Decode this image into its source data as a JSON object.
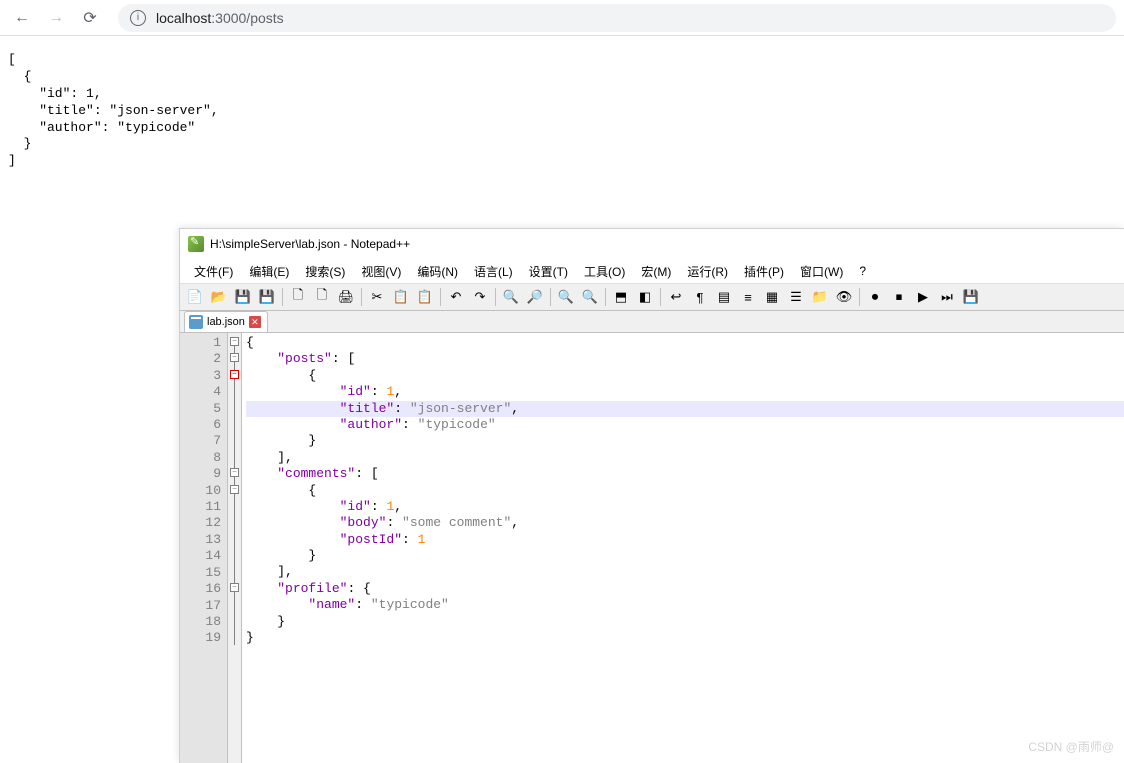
{
  "browser": {
    "url_host": "localhost",
    "url_port_path": ":3000/posts",
    "content_lines": [
      "[",
      "  {",
      "    \"id\": 1,",
      "    \"title\": \"json-server\",",
      "    \"author\": \"typicode\"",
      "  }",
      "]"
    ]
  },
  "notepad": {
    "title": "H:\\simpleServer\\lab.json - Notepad++",
    "menu": [
      "文件(F)",
      "编辑(E)",
      "搜索(S)",
      "视图(V)",
      "编码(N)",
      "语言(L)",
      "设置(T)",
      "工具(O)",
      "宏(M)",
      "运行(R)",
      "插件(P)",
      "窗口(W)",
      "?"
    ],
    "tab_label": "lab.json",
    "line_count": 19,
    "highlighted_line": 5,
    "code_lines": [
      {
        "indent": "",
        "tokens": [
          {
            "t": "brace",
            "v": "{"
          }
        ]
      },
      {
        "indent": "    ",
        "tokens": [
          {
            "t": "key",
            "v": "\"posts\""
          },
          {
            "t": "colon",
            "v": ": "
          },
          {
            "t": "brace",
            "v": "["
          }
        ]
      },
      {
        "indent": "        ",
        "tokens": [
          {
            "t": "brace",
            "v": "{"
          }
        ]
      },
      {
        "indent": "            ",
        "tokens": [
          {
            "t": "key",
            "v": "\"id\""
          },
          {
            "t": "colon",
            "v": ": "
          },
          {
            "t": "num",
            "v": "1"
          },
          {
            "t": "brace",
            "v": ","
          }
        ]
      },
      {
        "indent": "            ",
        "tokens": [
          {
            "t": "key",
            "v": "\"title\""
          },
          {
            "t": "colon",
            "v": ": "
          },
          {
            "t": "str",
            "v": "\"json-server\""
          },
          {
            "t": "brace",
            "v": ","
          }
        ]
      },
      {
        "indent": "            ",
        "tokens": [
          {
            "t": "key",
            "v": "\"author\""
          },
          {
            "t": "colon",
            "v": ": "
          },
          {
            "t": "str",
            "v": "\"typicode\""
          }
        ]
      },
      {
        "indent": "        ",
        "tokens": [
          {
            "t": "brace",
            "v": "}"
          }
        ]
      },
      {
        "indent": "    ",
        "tokens": [
          {
            "t": "brace",
            "v": "],"
          }
        ]
      },
      {
        "indent": "    ",
        "tokens": [
          {
            "t": "key",
            "v": "\"comments\""
          },
          {
            "t": "colon",
            "v": ": "
          },
          {
            "t": "brace",
            "v": "["
          }
        ]
      },
      {
        "indent": "        ",
        "tokens": [
          {
            "t": "brace",
            "v": "{"
          }
        ]
      },
      {
        "indent": "            ",
        "tokens": [
          {
            "t": "key",
            "v": "\"id\""
          },
          {
            "t": "colon",
            "v": ": "
          },
          {
            "t": "num",
            "v": "1"
          },
          {
            "t": "brace",
            "v": ","
          }
        ]
      },
      {
        "indent": "            ",
        "tokens": [
          {
            "t": "key",
            "v": "\"body\""
          },
          {
            "t": "colon",
            "v": ": "
          },
          {
            "t": "str",
            "v": "\"some comment\""
          },
          {
            "t": "brace",
            "v": ","
          }
        ]
      },
      {
        "indent": "            ",
        "tokens": [
          {
            "t": "key",
            "v": "\"postId\""
          },
          {
            "t": "colon",
            "v": ": "
          },
          {
            "t": "num",
            "v": "1"
          }
        ]
      },
      {
        "indent": "        ",
        "tokens": [
          {
            "t": "brace",
            "v": "}"
          }
        ]
      },
      {
        "indent": "    ",
        "tokens": [
          {
            "t": "brace",
            "v": "],"
          }
        ]
      },
      {
        "indent": "    ",
        "tokens": [
          {
            "t": "key",
            "v": "\"profile\""
          },
          {
            "t": "colon",
            "v": ": "
          },
          {
            "t": "brace",
            "v": "{"
          }
        ]
      },
      {
        "indent": "        ",
        "tokens": [
          {
            "t": "key",
            "v": "\"name\""
          },
          {
            "t": "colon",
            "v": ": "
          },
          {
            "t": "str",
            "v": "\"typicode\""
          }
        ]
      },
      {
        "indent": "    ",
        "tokens": [
          {
            "t": "brace",
            "v": "}"
          }
        ]
      },
      {
        "indent": "",
        "tokens": [
          {
            "t": "brace",
            "v": "}"
          }
        ]
      }
    ],
    "fold_marks": [
      {
        "line": 1,
        "open": true
      },
      {
        "line": 2,
        "open": true
      },
      {
        "line": 3,
        "open": true,
        "red": true
      },
      {
        "line": 9,
        "open": true
      },
      {
        "line": 10,
        "open": true
      },
      {
        "line": 16,
        "open": true
      }
    ],
    "toolbar_icons": [
      "new-file-icon",
      "open-file-icon",
      "save-icon",
      "save-all-icon",
      "sep",
      "close-icon",
      "close-all-icon",
      "print-icon",
      "sep",
      "cut-icon",
      "copy-icon",
      "paste-icon",
      "sep",
      "undo-icon",
      "redo-icon",
      "sep",
      "find-icon",
      "replace-icon",
      "sep",
      "zoom-in-icon",
      "zoom-out-icon",
      "sep",
      "sync-v-icon",
      "sync-h-icon",
      "sep",
      "wrap-icon",
      "show-all-icon",
      "indent-guide-icon",
      "lang-icon",
      "doc-map-icon",
      "func-list-icon",
      "folder-icon",
      "monitor-icon",
      "sep",
      "record-icon",
      "stop-icon",
      "play-icon",
      "play-multi-icon",
      "save-macro-icon"
    ]
  },
  "watermark": "CSDN @雨师@",
  "toolbar_glyphs": {
    "new-file-icon": "📄",
    "open-file-icon": "📂",
    "save-icon": "💾",
    "save-all-icon": "💾",
    "close-icon": "🗋",
    "close-all-icon": "🗋",
    "print-icon": "🖨",
    "cut-icon": "✂",
    "copy-icon": "📋",
    "paste-icon": "📋",
    "undo-icon": "↶",
    "redo-icon": "↷",
    "find-icon": "🔍",
    "replace-icon": "🔎",
    "zoom-in-icon": "🔍",
    "zoom-out-icon": "🔍",
    "sync-v-icon": "⬒",
    "sync-h-icon": "◧",
    "wrap-icon": "↩",
    "show-all-icon": "¶",
    "indent-guide-icon": "▤",
    "lang-icon": "≡",
    "doc-map-icon": "▦",
    "func-list-icon": "☰",
    "folder-icon": "📁",
    "monitor-icon": "👁",
    "record-icon": "⏺",
    "stop-icon": "⏹",
    "play-icon": "▶",
    "play-multi-icon": "⏭",
    "save-macro-icon": "💾"
  }
}
